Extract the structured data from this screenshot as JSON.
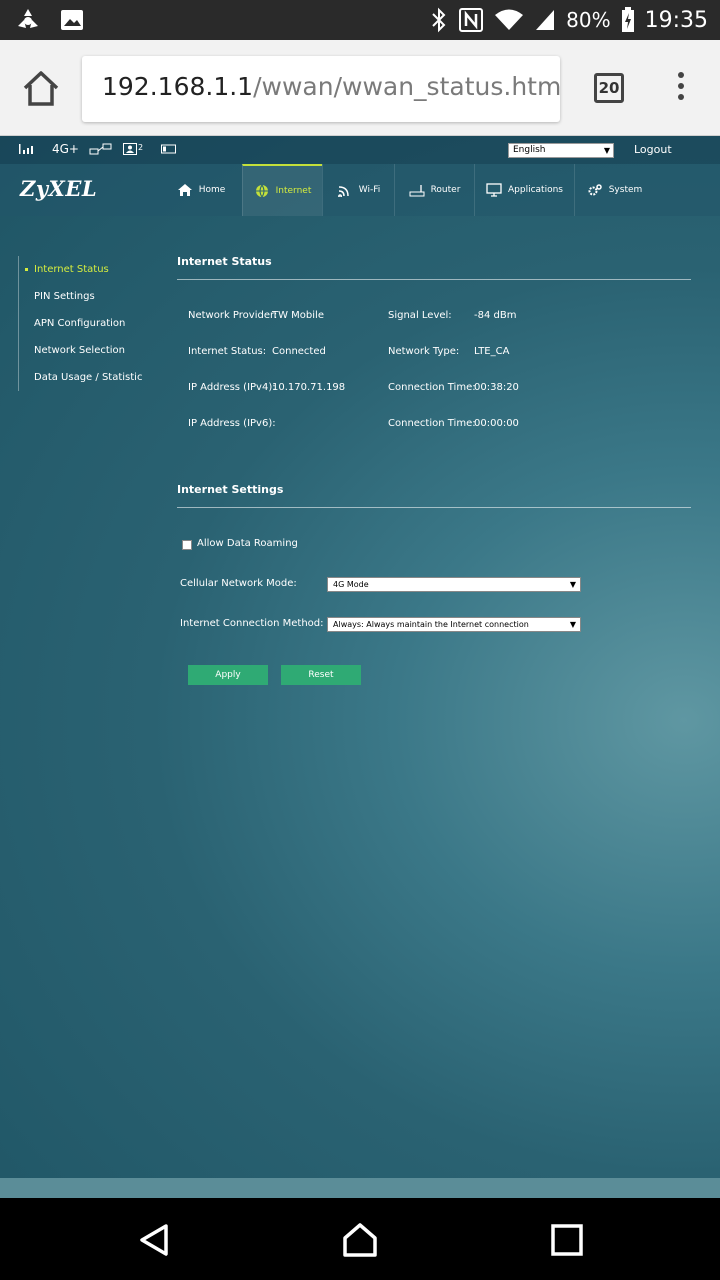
{
  "status_bar": {
    "battery": "80%",
    "time": "19:35",
    "icons": [
      "pinwheel-icon",
      "image-icon",
      "bluetooth-icon",
      "nfc-icon",
      "wifi-icon",
      "cell-signal-icon",
      "battery-charging-icon"
    ]
  },
  "browser": {
    "url_host": "192.168.1.1",
    "url_path": "/wwan/wwan_status.htm",
    "tab_count": "20"
  },
  "router": {
    "topbar": {
      "network_type": "4G+",
      "connected_users": "2",
      "language": "English",
      "logout": "Logout"
    },
    "brand": "ZyXEL",
    "nav": [
      {
        "label": "Home",
        "icon": "home-icon"
      },
      {
        "label": "Internet",
        "icon": "globe-icon"
      },
      {
        "label": "Wi-Fi",
        "icon": "wifi-icon"
      },
      {
        "label": "Router",
        "icon": "router-icon"
      },
      {
        "label": "Applications",
        "icon": "monitor-icon"
      },
      {
        "label": "System",
        "icon": "gear-icon"
      }
    ],
    "active_nav": "Internet",
    "sidebar": [
      {
        "label": "Internet Status"
      },
      {
        "label": "PIN Settings"
      },
      {
        "label": "APN Configuration"
      },
      {
        "label": "Network Selection"
      },
      {
        "label": "Data Usage / Statistic"
      }
    ],
    "internet_status": {
      "title": "Internet Status",
      "network_provider_label": "Network Provider:",
      "network_provider": "TW Mobile",
      "internet_status_label": "Internet Status:",
      "internet_status": "Connected",
      "ipv4_label": "IP Address (IPv4):",
      "ipv4": "10.170.71.198",
      "ipv6_label": "IP Address (IPv6):",
      "signal_level_label": "Signal Level:",
      "signal_level": "-84 dBm",
      "network_type_label": "Network Type:",
      "network_type": "LTE_CA",
      "connection_time_label": "Connection Time:",
      "connection_time_v4": "00:38:20",
      "connection_time_v6": "00:00:00"
    },
    "internet_settings": {
      "title": "Internet Settings",
      "allow_roaming_label": "Allow Data Roaming",
      "allow_roaming_checked": false,
      "cellular_mode_label": "Cellular Network Mode:",
      "cellular_mode_value": "4G Mode",
      "connection_method_label": "Internet Connection Method:",
      "connection_method_value": "Always: Always maintain the Internet connection",
      "apply": "Apply",
      "reset": "Reset"
    }
  },
  "colors": {
    "accent_active": "#d5ec3e",
    "button_green": "#2faa74"
  }
}
